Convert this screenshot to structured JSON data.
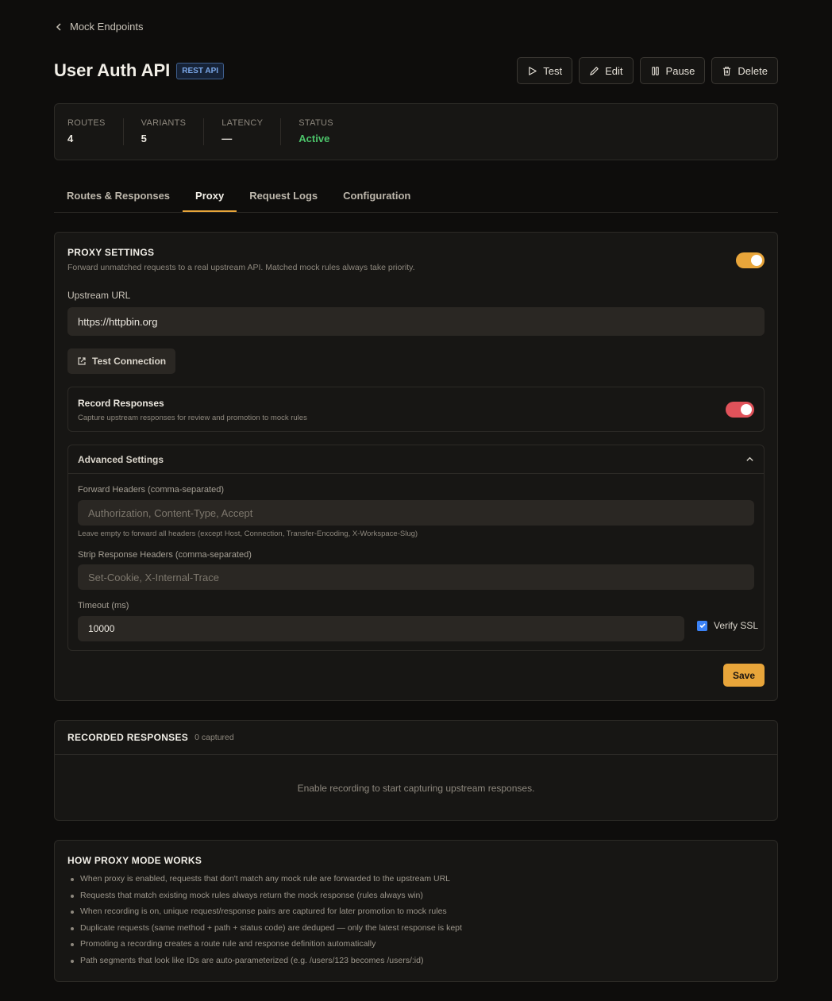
{
  "nav": {
    "back_label": "Mock Endpoints"
  },
  "header": {
    "title": "User Auth API",
    "badge": "REST API",
    "actions": {
      "test": "Test",
      "edit": "Edit",
      "pause": "Pause",
      "delete": "Delete"
    }
  },
  "stats": [
    {
      "label": "ROUTES",
      "value": "4"
    },
    {
      "label": "VARIANTS",
      "value": "5"
    },
    {
      "label": "LATENCY",
      "value": "—"
    },
    {
      "label": "STATUS",
      "value": "Active"
    }
  ],
  "tabs": [
    "Routes & Responses",
    "Proxy",
    "Request Logs",
    "Configuration"
  ],
  "active_tab": "Proxy",
  "proxy": {
    "title": "PROXY SETTINGS",
    "description": "Forward unmatched requests to a real upstream API. Matched mock rules always take priority.",
    "enabled": true,
    "upstream_label": "Upstream URL",
    "upstream_value": "https://httpbin.org",
    "test_connection": "Test Connection",
    "record": {
      "title": "Record Responses",
      "description": "Capture upstream responses for review and promotion to mock rules",
      "enabled": true
    },
    "advanced": {
      "title": "Advanced Settings",
      "forward_headers_label": "Forward Headers (comma-separated)",
      "forward_headers_placeholder": "Authorization, Content-Type, Accept",
      "forward_headers_hint": "Leave empty to forward all headers (except Host, Connection, Transfer-Encoding, X-Workspace-Slug)",
      "strip_headers_label": "Strip Response Headers (comma-separated)",
      "strip_headers_placeholder": "Set-Cookie, X-Internal-Trace",
      "timeout_label": "Timeout (ms)",
      "timeout_value": "10000",
      "verify_ssl_label": "Verify SSL",
      "verify_ssl": true
    },
    "save_label": "Save"
  },
  "recorded": {
    "title": "RECORDED RESPONSES",
    "count": "0 captured",
    "empty": "Enable recording to start capturing upstream responses."
  },
  "how": {
    "title": "HOW PROXY MODE WORKS",
    "items": [
      "When proxy is enabled, requests that don't match any mock rule are forwarded to the upstream URL",
      "Requests that match existing mock rules always return the mock response (rules always win)",
      "When recording is on, unique request/response pairs are captured for later promotion to mock rules",
      "Duplicate requests (same method + path + status code) are deduped — only the latest response is kept",
      "Promoting a recording creates a route rule and response definition automatically",
      "Path segments that look like IDs are auto-parameterized (e.g. /users/123 becomes /users/:id)"
    ]
  },
  "colors": {
    "accent": "#e8a53a",
    "active_status": "#4cc46a",
    "record_toggle": "#e0525a",
    "badge": "#7aa7e8"
  }
}
